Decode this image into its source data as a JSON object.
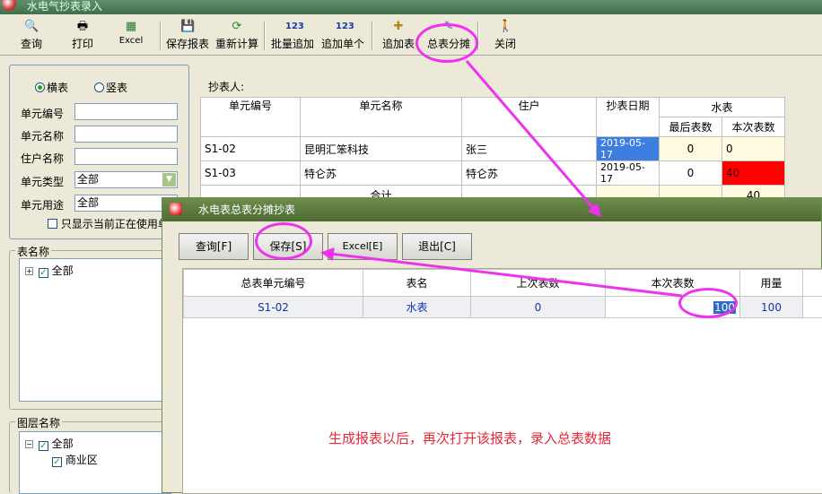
{
  "app": {
    "title": "水电气抄表录入"
  },
  "toolbar": [
    {
      "label": "查询",
      "icon": "search-document-icon"
    },
    {
      "label": "打印",
      "icon": "printer-icon"
    },
    {
      "label": "Excel",
      "icon": "excel-icon"
    },
    {
      "label": "保存报表",
      "icon": "save-disk-icon"
    },
    {
      "label": "重新计算",
      "icon": "recalculate-icon"
    },
    {
      "label": "批量追加",
      "icon": "batch-add-icon"
    },
    {
      "label": "追加单个",
      "icon": "add-single-icon"
    },
    {
      "label": "追加表",
      "icon": "add-meter-icon"
    },
    {
      "label": "总表分摊",
      "icon": "total-meter-allocate-icon"
    },
    {
      "label": "关闭",
      "icon": "close-person-icon"
    }
  ],
  "filters": {
    "orientation_h": "横表",
    "orientation_v": "竖表",
    "unit_code_label": "单元编号",
    "unit_name_label": "单元名称",
    "tenant_name_label": "住户名称",
    "unit_type_label": "单元类型",
    "unit_type_value": "全部",
    "unit_use_label": "单元用途",
    "unit_use_value": "全部",
    "only_in_use": "只显示当前正在使用单"
  },
  "meter_tree": {
    "title": "表名称",
    "root": "全部"
  },
  "layer_tree": {
    "title": "图层名称",
    "root": "全部",
    "child": "商业区"
  },
  "main": {
    "reader_label": "抄表人:",
    "headers": {
      "unit_code": "单元编号",
      "unit_name": "单元名称",
      "tenant": "住户",
      "read_date": "抄表日期",
      "water": "水表",
      "last_reading": "最后表数",
      "current_reading": "本次表数"
    },
    "rows": [
      {
        "unit_code": "S1-02",
        "unit_name": "昆明汇笨科技",
        "tenant": "张三",
        "date": "2019-05-17",
        "last": "0",
        "current": "0"
      },
      {
        "unit_code": "S1-03",
        "unit_name": "特仑苏",
        "tenant": "特仑苏",
        "date": "2019-05-17",
        "last": "0",
        "current": "40"
      }
    ],
    "total_label": "合计",
    "total_current": "40"
  },
  "dialog": {
    "title": "水电表总表分摊抄表",
    "buttons": [
      "查询[F]",
      "保存[S]",
      "Excel[E]",
      "退出[C]"
    ],
    "headers": [
      "总表单元编号",
      "表名",
      "上次表数",
      "本次表数",
      "用量"
    ],
    "row": {
      "unit_code": "S1-02",
      "meter": "水表",
      "last": "0",
      "current": "100",
      "usage": "100"
    },
    "annotation": "生成报表以后，再次打开该报表，录入总表数据"
  },
  "colors": {
    "highlight_date": "#3d7fe0",
    "highlight_red": "#ff0000",
    "annotation": "#e8273a",
    "callout": "#ee33ee"
  }
}
